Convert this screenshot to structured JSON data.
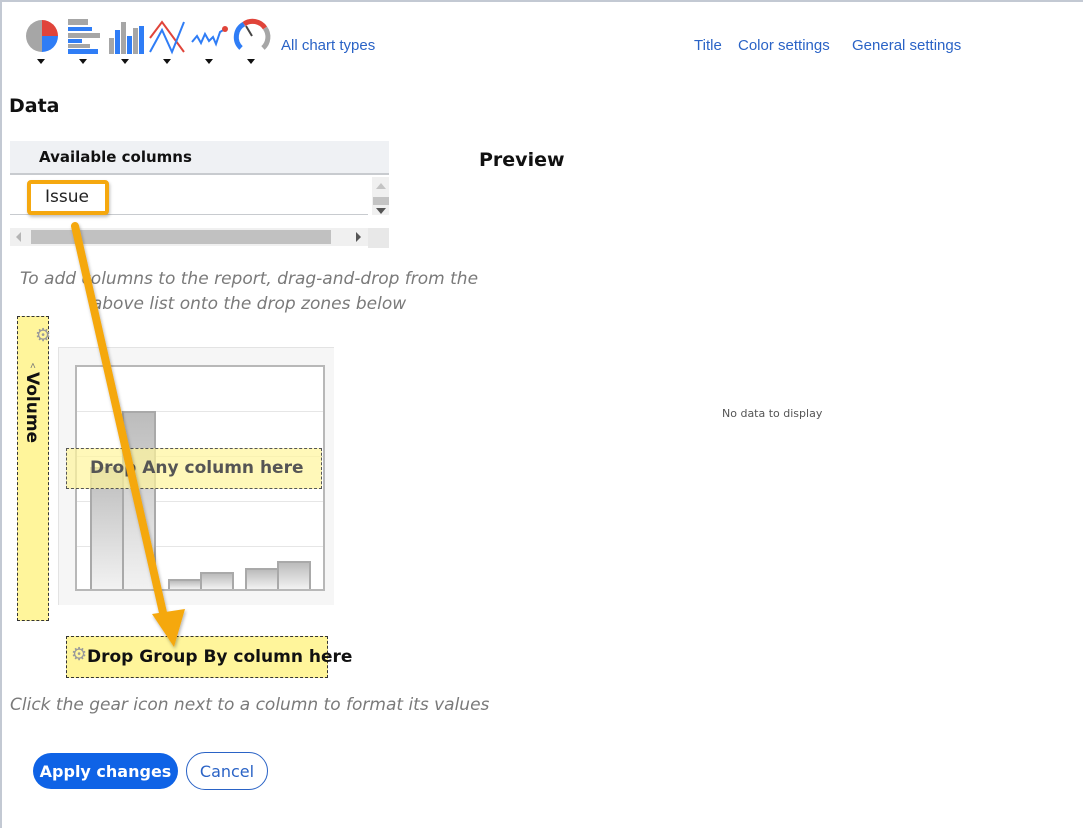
{
  "toolbar": {
    "chart_types": [
      {
        "name": "pie-chart-icon",
        "label": "Pie"
      },
      {
        "name": "horizontal-bar-chart-icon",
        "label": "Bar"
      },
      {
        "name": "column-chart-icon",
        "label": "Column"
      },
      {
        "name": "line-chart-icon",
        "label": "Line"
      },
      {
        "name": "sparkline-chart-icon",
        "label": "Spark"
      },
      {
        "name": "gauge-chart-icon",
        "label": "Gauge"
      }
    ],
    "all_chart_types": "All chart types",
    "links": {
      "title": "Title",
      "color_settings": "Color settings",
      "general_settings": "General settings"
    }
  },
  "data_section": {
    "heading": "Data",
    "available_columns": {
      "header": "Available columns",
      "items": [
        "Issue"
      ]
    },
    "drag_hint": "To add columns to the report, drag-and-drop from the above list onto the drop zones below",
    "y_axis_zone": {
      "label": "Volume"
    },
    "x_axis_zone": {
      "label": "Drop Any column here"
    },
    "group_by_zone": {
      "label": "Drop Group By column here"
    },
    "gear_hint": "Click the gear icon next to a column to format its values"
  },
  "preview": {
    "heading": "Preview",
    "empty_message": "No data to display"
  },
  "actions": {
    "apply": "Apply changes",
    "cancel": "Cancel"
  },
  "colors": {
    "accent": "#0f63e6",
    "link": "#2a63c6",
    "highlight": "#f5a80f",
    "drop_zone": "#fff59b"
  }
}
